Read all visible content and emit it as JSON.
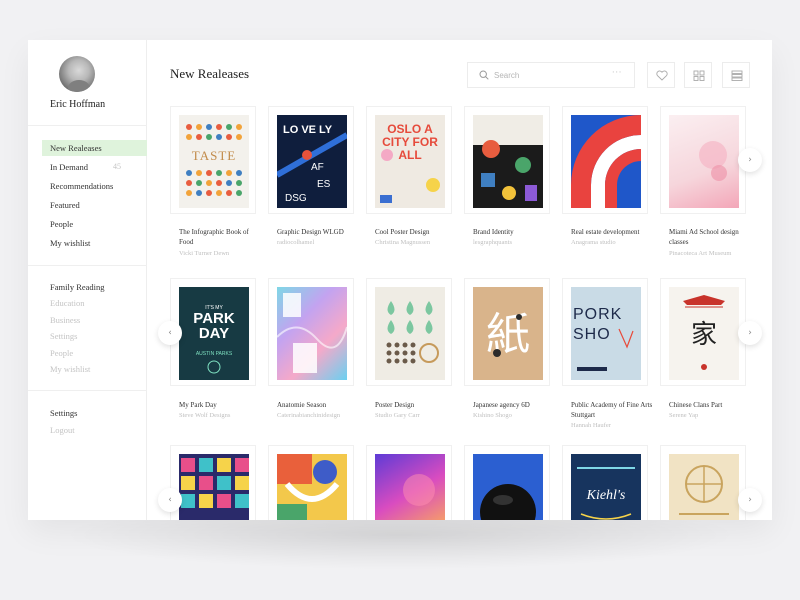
{
  "user": {
    "name": "Eric Hoffman"
  },
  "page": {
    "title": "New Realeases"
  },
  "search": {
    "placeholder": "Search",
    "more": "···"
  },
  "nav_primary": [
    {
      "label": "New Realeases",
      "active": true
    },
    {
      "label": "In Demand",
      "badge": "45"
    },
    {
      "label": "Recommendations"
    },
    {
      "label": "Featured"
    },
    {
      "label": "People"
    },
    {
      "label": "My wishlist"
    }
  ],
  "nav_secondary": [
    {
      "label": "Family Reading",
      "muted": false
    },
    {
      "label": "Education",
      "muted": true
    },
    {
      "label": "Business",
      "muted": true
    },
    {
      "label": "Settings",
      "muted": true
    },
    {
      "label": "People",
      "muted": true
    },
    {
      "label": "My wishlist",
      "muted": true
    }
  ],
  "nav_footer": [
    {
      "label": "Settings",
      "muted": false
    },
    {
      "label": "Logout",
      "muted": true
    }
  ],
  "rows": [
    [
      {
        "title": "The Infographic Book of Food",
        "author": "Vicki Turner Dewn",
        "poster": "taste",
        "poster_text": "TASTE"
      },
      {
        "title": "Graphic Design WLGD",
        "author": "radiocolhamel",
        "poster": "lovely",
        "poster_text": "LO VE LY"
      },
      {
        "title": "Cool Poster Design",
        "author": "Christina Magnussen",
        "poster": "oslo",
        "poster_text": "OSLO A CITY FOR ALL"
      },
      {
        "title": "Brand Identity",
        "author": "lesgraphquants",
        "poster": "brand",
        "poster_text": ""
      },
      {
        "title": "Real estate development",
        "author": "Anagrama studio",
        "poster": "realestate",
        "poster_text": ""
      },
      {
        "title": "Miami Ad School design classes",
        "author": "Pinacoteca Art Museum",
        "poster": "miami",
        "poster_text": ""
      }
    ],
    [
      {
        "title": "My Park Day",
        "author": "Steve Wolf Designs",
        "poster": "park",
        "poster_text": "PARK DAY"
      },
      {
        "title": "Anatomie Season",
        "author": "Caterinabianchinidesign",
        "poster": "anatomie",
        "poster_text": ""
      },
      {
        "title": "Poster Design",
        "author": "Studio Gary Carr",
        "poster": "drops",
        "poster_text": ""
      },
      {
        "title": "Japanese agency 6D",
        "author": "Kishino Shogo",
        "poster": "japan",
        "poster_text": "紙"
      },
      {
        "title": "Public Academy of Fine Arts Stuttgart",
        "author": "Hannah Haufer",
        "poster": "pork",
        "poster_text": "PORK SHO"
      },
      {
        "title": "Chinese Clans Part",
        "author": "Serene Yap",
        "poster": "chinese",
        "poster_text": "家"
      }
    ],
    [
      {
        "title": "",
        "author": "",
        "poster": "pattern",
        "poster_text": ""
      },
      {
        "title": "",
        "author": "",
        "poster": "shapes",
        "poster_text": ""
      },
      {
        "title": "",
        "author": "",
        "poster": "gradient",
        "poster_text": ""
      },
      {
        "title": "",
        "author": "",
        "poster": "sphere",
        "poster_text": ""
      },
      {
        "title": "",
        "author": "",
        "poster": "kiehls",
        "poster_text": "Kiehl's"
      },
      {
        "title": "",
        "author": "",
        "poster": "gold",
        "poster_text": ""
      }
    ]
  ],
  "arrows": {
    "next": "›",
    "prev": "‹"
  },
  "colors": {
    "active_nav": "#dff3dc",
    "muted_text": "#c4c4c4",
    "accent_text": "#222222"
  }
}
